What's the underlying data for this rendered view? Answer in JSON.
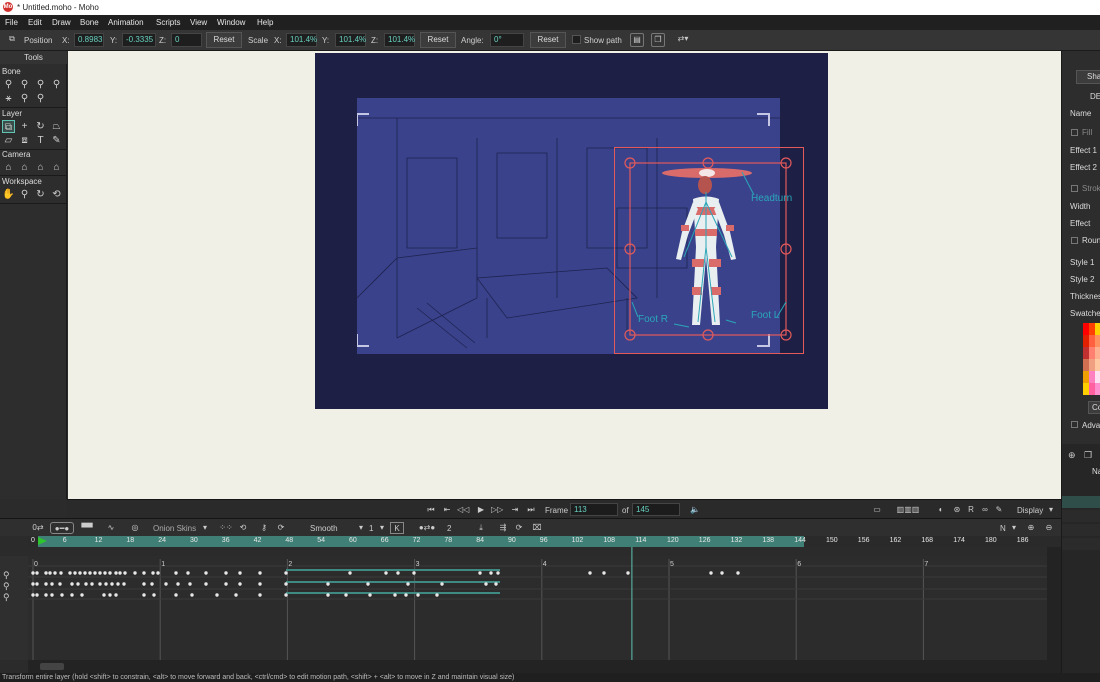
{
  "window": {
    "title": "* Untitled.moho - Moho",
    "logo": "Mo"
  },
  "menu": [
    "File",
    "Edit",
    "Draw",
    "Bone",
    "Animation",
    "Scripts",
    "View",
    "Window",
    "Help"
  ],
  "toolbar": {
    "position_label": "Position",
    "x_label": "X:",
    "x_value": "0.8983",
    "y_label": "Y:",
    "y_value": "-0.3335",
    "z_label": "Z:",
    "z_value": "0",
    "reset1": "Reset",
    "scale_label": "Scale",
    "sx_label": "X:",
    "sx_value": "101.4%",
    "sy_label": "Y:",
    "sy_value": "101.4%",
    "sz_label": "Z:",
    "sz_value": "101.4%",
    "reset2": "Reset",
    "angle_label": "Angle:",
    "angle_value": "0°",
    "reset3": "Reset",
    "show_path_label": "Show path"
  },
  "tools": {
    "header": "Tools",
    "sections": [
      "Bone",
      "Layer",
      "Camera",
      "Workspace"
    ]
  },
  "canvas": {
    "bone_labels": [
      "Headturn",
      "Foot R",
      "Foot L"
    ],
    "accent": "#2aa7b8",
    "selection_color": "#e25a5a",
    "stage_color": "#1d1f45"
  },
  "right_panel": {
    "top_btn": "Sha",
    "de_label": "DE",
    "name_label": "Name",
    "fill_label": "Fill",
    "effect1": "Effect 1",
    "effect2": "Effect 2",
    "stroke_label": "Strok",
    "width_label": "Width",
    "effect_label": "Effect",
    "round_label": "Roun",
    "style1": "Style 1",
    "style2": "Style 2",
    "thickness_label": "Thicknes",
    "swatches_label": "Swatches",
    "co_btn": "Co",
    "adv_label": "Advar",
    "layers_name": "Name"
  },
  "playback": {
    "frame_label": "Frame",
    "frame_value": "113",
    "of_label": "of",
    "of_value": "145",
    "display_label": "Display"
  },
  "timeline": {
    "onion_label": "Onion Skins",
    "interp": "Smooth",
    "interp_num": "1",
    "step": "2",
    "n_label": "N",
    "ruler_ticks": [
      "0",
      "6",
      "12",
      "18",
      "24",
      "30",
      "36",
      "42",
      "48",
      "54",
      "60",
      "66",
      "72",
      "78",
      "84",
      "90",
      "96",
      "102",
      "108",
      "114",
      "120",
      "126",
      "132",
      "138",
      "144",
      "150",
      "156",
      "162",
      "168",
      "174",
      "180",
      "186"
    ],
    "second_marks": [
      "0",
      "1",
      "2",
      "3",
      "4",
      "5",
      "6",
      "7"
    ],
    "current_frame": 113
  },
  "status": "Transform entire layer (hold <shift> to constrain, <alt> to move forward and back, <ctrl/cmd> to edit motion path, <shift> + <alt> to move in Z and maintain visual size)"
}
